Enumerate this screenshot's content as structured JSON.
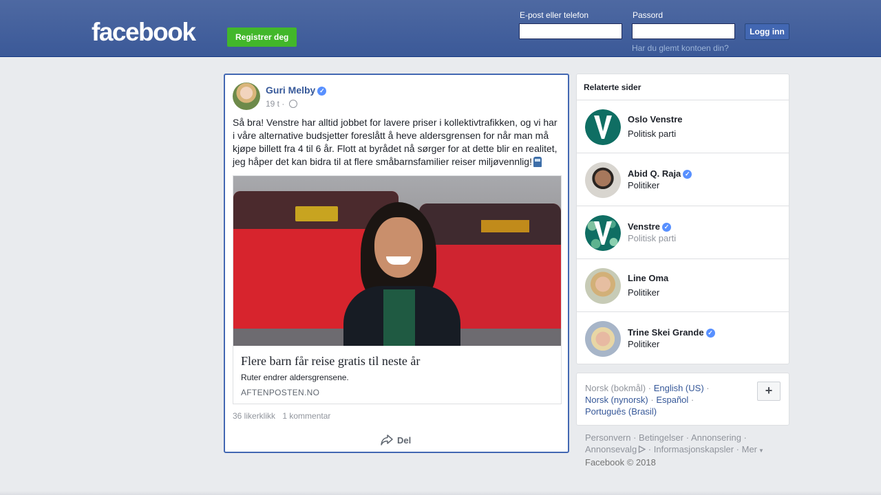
{
  "header": {
    "logo": "facebook",
    "register_label": "Registrer deg",
    "email_label": "E-post eller telefon",
    "password_label": "Passord",
    "login_label": "Logg inn",
    "forgot_label": "Har du glemt kontoen din?",
    "email_value": "",
    "password_value": ""
  },
  "post": {
    "author": "Guri Melby",
    "verified": true,
    "time": "19 t",
    "text": "Så bra! Venstre har alltid jobbet for lavere priser i kollektivtrafikken, og vi har i våre alternative budsjetter foreslått å heve aldersgrensen for når man må kjøpe billett fra 4 til 6 år. Flott at byrådet nå sørger for at dette blir en realitet, jeg håper det kan bidra til at flere småbarnsfamilier reiser miljøvennlig!",
    "emoji_icon": "train-icon",
    "link": {
      "title": "Flere barn får reise gratis til neste år",
      "description": "Ruter endrer aldersgrensene.",
      "domain": "AFTENPOSTEN.NO"
    },
    "likes": "36 likerklikk",
    "comments": "1 kommentar",
    "share_label": "Del"
  },
  "related": {
    "title": "Relaterte sider",
    "items": [
      {
        "name": "Oslo Venstre",
        "subtitle": "Politisk parti",
        "verified": false
      },
      {
        "name": "Abid Q. Raja",
        "subtitle": "Politiker",
        "verified": true
      },
      {
        "name": "Venstre",
        "subtitle": "Politisk parti",
        "verified": true
      },
      {
        "name": "Line Oma",
        "subtitle": "Politiker",
        "verified": false
      },
      {
        "name": "Trine Skei Grande",
        "subtitle": "Politiker",
        "verified": true
      }
    ]
  },
  "languages": {
    "current": "Norsk (bokmål)",
    "others": [
      "English (US)",
      "Norsk (nynorsk)",
      "Español",
      "Português (Brasil)"
    ],
    "more_label": "+"
  },
  "footer": {
    "links": [
      "Personvern",
      "Betingelser",
      "Annonsering",
      "Annonsevalg",
      "Informasjonskapsler",
      "Mer"
    ],
    "copyright": "Facebook © 2018"
  },
  "colors": {
    "brand_blue": "#3b5998",
    "link_blue": "#365899",
    "register_green": "#42b72a",
    "verified_blue": "#5890ff"
  }
}
